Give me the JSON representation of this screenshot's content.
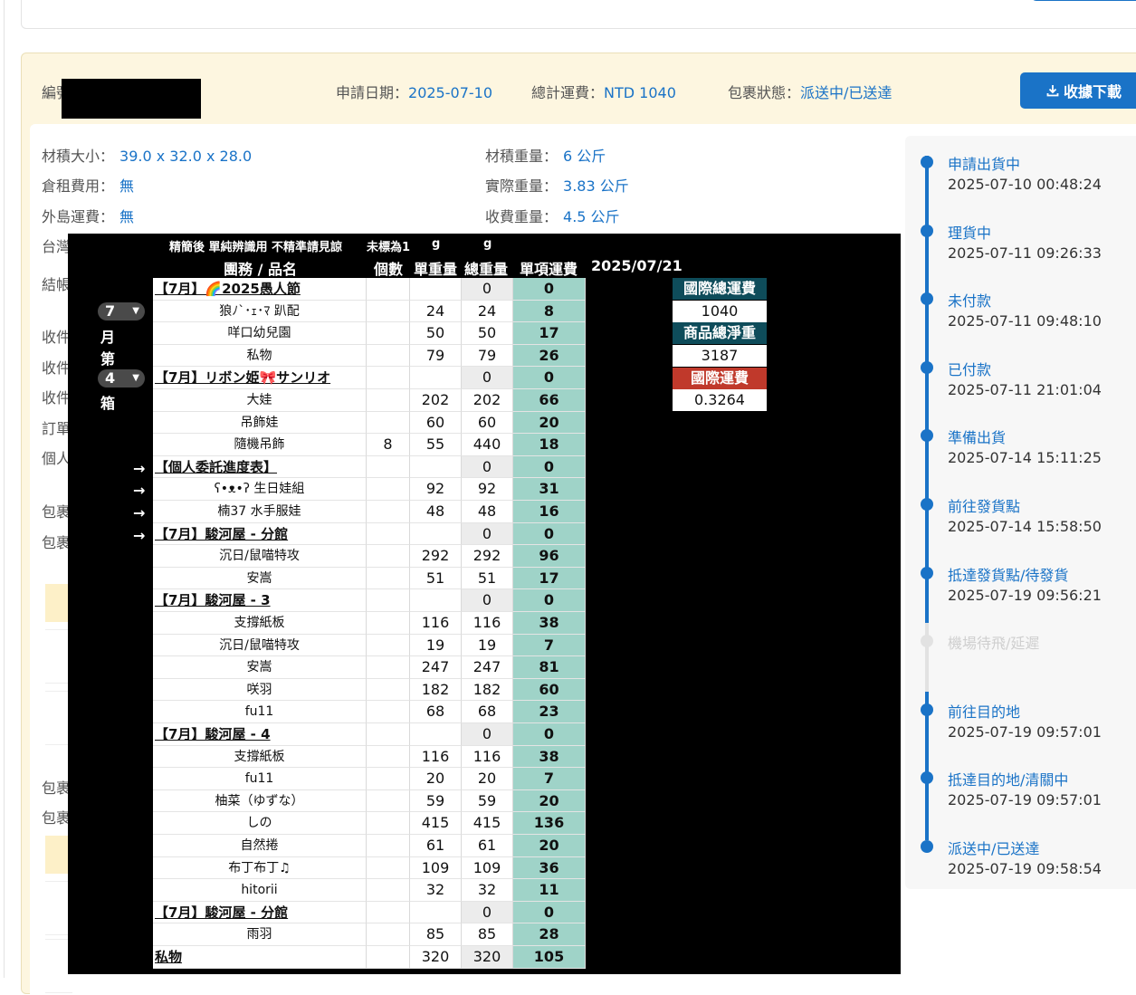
{
  "order": {
    "id_label": "編號",
    "apply_date_label": "申請日期：",
    "apply_date": "2025-07-10",
    "total_fee_label": "總計運費：",
    "total_fee": "NTD 1040",
    "status_label": "包裹狀態：",
    "status": "派送中/已送達",
    "download_label": "收據下載"
  },
  "details": {
    "volume_label": "材積大小：",
    "volume": "39.0 x 32.0 x 28.0",
    "storage_label": "倉租費用：",
    "storage": "無",
    "island_label": "外島運費：",
    "island": "無",
    "vol_weight_label": "材積重量：",
    "vol_weight": "6 公斤",
    "actual_weight_label": "實際重量：",
    "actual_weight": "3.83 公斤",
    "charge_weight_label": "收費重量：",
    "charge_weight": "4.5 公斤",
    "cut_labels": [
      "台灣",
      "結帳",
      "收件",
      "收件",
      "收件",
      "訂單",
      "個人",
      "包裹",
      "包裹",
      "包裹",
      "包裹"
    ]
  },
  "timeline": [
    {
      "title": "申請出貨中",
      "time": "2025-07-10 00:48:24",
      "done": true
    },
    {
      "title": "理貨中",
      "time": "2025-07-11 09:26:33",
      "done": true
    },
    {
      "title": "未付款",
      "time": "2025-07-11 09:48:10",
      "done": true
    },
    {
      "title": "已付款",
      "time": "2025-07-11 21:01:04",
      "done": true
    },
    {
      "title": "準備出貨",
      "time": "2025-07-14 15:11:25",
      "done": true
    },
    {
      "title": "前往發貨點",
      "time": "2025-07-14 15:58:50",
      "done": true
    },
    {
      "title": "抵達發貨點/待發貨",
      "time": "2025-07-19 09:56:21",
      "done": true
    },
    {
      "title": "機場待飛/延遲",
      "time": "",
      "done": false
    },
    {
      "title": "前往目的地",
      "time": "2025-07-19 09:57:01",
      "done": true
    },
    {
      "title": "抵達目的地/清關中",
      "time": "2025-07-19 09:57:01",
      "done": true
    },
    {
      "title": "派送中/已送達",
      "time": "2025-07-19 09:58:54",
      "done": true
    }
  ],
  "sheet": {
    "note1": "精簡後 單純辨識用 不精準請見諒",
    "note2": "未標為1",
    "unit_g1": "g",
    "unit_g2": "g",
    "col_name": "團務 / 品名",
    "col_count": "個數",
    "col_unit": "單重量",
    "col_total": "總重量",
    "col_fee": "單項運費",
    "date": "2025/07/21",
    "side_month": "7",
    "side_month_unit": "月",
    "side_no": "第",
    "side_box": "4",
    "side_box_unit": "箱",
    "arrow": "→",
    "summary": {
      "intl_total_label": "國際總運費",
      "intl_total": "1040",
      "net_weight_label": "商品總淨重",
      "net_weight": "3187",
      "intl_fee_label": "國際運費",
      "intl_fee": "0.3264"
    },
    "rows": [
      {
        "name": "【7月】🌈2025愚人節",
        "group": true,
        "count": "",
        "unit": "",
        "total": "0",
        "fee": "0"
      },
      {
        "name": "狼ﾉ`･ｪ･ﾏ 趴配",
        "group": false,
        "count": "",
        "unit": "24",
        "total": "24",
        "fee": "8"
      },
      {
        "name": "咩口幼兒園",
        "group": false,
        "count": "",
        "unit": "50",
        "total": "50",
        "fee": "17"
      },
      {
        "name": "私物",
        "group": false,
        "count": "",
        "unit": "79",
        "total": "79",
        "fee": "26"
      },
      {
        "name": "【7月】リボン姫🎀サンリオ",
        "group": true,
        "count": "",
        "unit": "",
        "total": "0",
        "fee": "0"
      },
      {
        "name": "大娃",
        "group": false,
        "count": "",
        "unit": "202",
        "total": "202",
        "fee": "66"
      },
      {
        "name": "吊飾娃",
        "group": false,
        "count": "",
        "unit": "60",
        "total": "60",
        "fee": "20"
      },
      {
        "name": "隨機吊飾",
        "group": false,
        "count": "8",
        "unit": "55",
        "total": "440",
        "fee": "18"
      },
      {
        "name": "【個人委託進度表】",
        "group": true,
        "count": "",
        "unit": "",
        "total": "0",
        "fee": "0"
      },
      {
        "name": "ʕ•ᴥ•ʔ 生日娃組",
        "group": false,
        "count": "",
        "unit": "92",
        "total": "92",
        "fee": "31"
      },
      {
        "name": "楠37 水手服娃",
        "group": false,
        "count": "",
        "unit": "48",
        "total": "48",
        "fee": "16"
      },
      {
        "name": "【7月】駿河屋 - 分館",
        "group": true,
        "count": "",
        "unit": "",
        "total": "0",
        "fee": "0"
      },
      {
        "name": "沉日/鼠喵特攻",
        "group": false,
        "count": "",
        "unit": "292",
        "total": "292",
        "fee": "96"
      },
      {
        "name": "安嵩",
        "group": false,
        "count": "",
        "unit": "51",
        "total": "51",
        "fee": "17"
      },
      {
        "name": "【7月】駿河屋 - 3",
        "group": true,
        "count": "",
        "unit": "",
        "total": "0",
        "fee": "0"
      },
      {
        "name": "支撐紙板",
        "group": false,
        "count": "",
        "unit": "116",
        "total": "116",
        "fee": "38"
      },
      {
        "name": "沉日/鼠喵特攻",
        "group": false,
        "count": "",
        "unit": "19",
        "total": "19",
        "fee": "7"
      },
      {
        "name": "安嵩",
        "group": false,
        "count": "",
        "unit": "247",
        "total": "247",
        "fee": "81"
      },
      {
        "name": "咲羽",
        "group": false,
        "count": "",
        "unit": "182",
        "total": "182",
        "fee": "60"
      },
      {
        "name": "fu11",
        "group": false,
        "count": "",
        "unit": "68",
        "total": "68",
        "fee": "23"
      },
      {
        "name": "【7月】駿河屋 - 4",
        "group": true,
        "count": "",
        "unit": "",
        "total": "0",
        "fee": "0"
      },
      {
        "name": "支撐紙板",
        "group": false,
        "count": "",
        "unit": "116",
        "total": "116",
        "fee": "38"
      },
      {
        "name": "fu11",
        "group": false,
        "count": "",
        "unit": "20",
        "total": "20",
        "fee": "7"
      },
      {
        "name": "柚菜（ゆずな）",
        "group": false,
        "count": "",
        "unit": "59",
        "total": "59",
        "fee": "20"
      },
      {
        "name": "しの",
        "group": false,
        "count": "",
        "unit": "415",
        "total": "415",
        "fee": "136"
      },
      {
        "name": "自然捲",
        "group": false,
        "count": "",
        "unit": "61",
        "total": "61",
        "fee": "20"
      },
      {
        "name": "布丁布丁♫",
        "group": false,
        "count": "",
        "unit": "109",
        "total": "109",
        "fee": "36"
      },
      {
        "name": "hitorii",
        "group": false,
        "count": "",
        "unit": "32",
        "total": "32",
        "fee": "11"
      },
      {
        "name": "【7月】駿河屋 - 分館",
        "group": true,
        "count": "",
        "unit": "",
        "total": "0",
        "fee": "0"
      },
      {
        "name": "雨羽",
        "group": false,
        "count": "",
        "unit": "85",
        "total": "85",
        "fee": "28"
      },
      {
        "name": "私物",
        "group": true,
        "count": "",
        "unit": "320",
        "total": "320",
        "fee": "105"
      }
    ]
  }
}
